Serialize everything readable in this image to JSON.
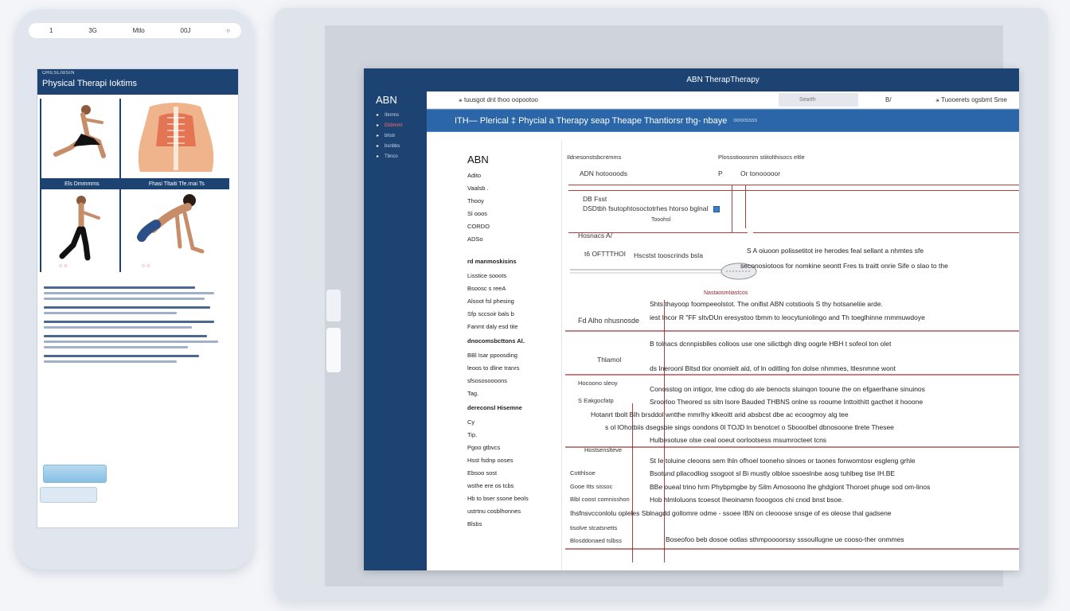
{
  "phone": {
    "status_bar": {
      "left": "1",
      "b": "3G",
      "center": "Mtlo",
      "right": "00J",
      "far_right": "○"
    },
    "header_kicker": "ORESLIBSIN",
    "header_title": "Physical Therapi Ioktims",
    "captions": [
      "Els  Dmmmms",
      "Fhasi  Tltaiti  Tfe.rnai  Ts"
    ],
    "badges": [
      "○ ○",
      "○ ○"
    ]
  },
  "app": {
    "title": "ABN TherapTherapy",
    "brand": "ABN",
    "sidebar_items": [
      {
        "icon": "▸",
        "label": "Ibnnns"
      },
      {
        "icon": "▸",
        "label": "Ebbmmt"
      },
      {
        "icon": "▸",
        "label": "bhstr"
      },
      {
        "icon": "▸",
        "label": "bsnbbs"
      },
      {
        "icon": "▸",
        "label": "Tbnco"
      }
    ],
    "toolbar": {
      "breadcrumb": "⚹ tuusgot dnt thoo oopootoo",
      "search_placeholder": "Searth",
      "count": "B/",
      "user": "⚹ Tuooerets  ogsbmt  Sme"
    },
    "banner": {
      "title": "ITH— Plerical ‡ Phycial a Therapy seap Theape Thantiorsr thg- nbaye",
      "sub": "oooossss"
    },
    "left_panel": {
      "heading": "ABN",
      "items": [
        "Adito",
        "Vaalsb .",
        "Thooy",
        "Sl ooos",
        "CORDO",
        "ADSo"
      ],
      "section1": "rd manmoskisins",
      "items2": [
        "Lisstice sooots",
        "Bsoosc s reeA",
        "Alsoot fsl phesing",
        "Sfp  sccsoir bals b",
        "Fanmt daly esd tite"
      ],
      "section2": "dnocomsbcttons Al.",
      "items3": [
        "BBl Isar ppoosding",
        "leoos  to dline tranrs",
        "sfsososoooons",
        "Tag."
      ],
      "section3": "dereconsl Hisemne",
      "items4": [
        "Cy",
        "Tip.",
        "Pgoo gtbvcs",
        "Hsst  fsdnp ooses",
        "Ebsoo sost",
        "wsthe ere os tcbs",
        "Hb  to bser  ssone beols",
        "ustrtnu cosblhonnes",
        "Blsbs"
      ]
    },
    "main": {
      "header_left": "Ildnesonstsbcntmms",
      "header_right": "Plossstioosmm  stiitolthisocs eltle",
      "col_a": "ADN hotoooods",
      "col_b": "P",
      "col_c": "Or  tonooooor",
      "r1": "DB  Fsst",
      "r2": "DSDtbh  fsutophtosoctotrhes  htorso  bglnal",
      "r2b": "Tooohsl",
      "r3": "Hosnacs A/",
      "r4": "t6  OFTTTHOI",
      "r4b": "Hscstst  tooscrinds  bsla",
      "r5": "S  A  oiuoon  polissetitot  ire  herodes  feal  sellant  a  nhmtes  sfe",
      "r6": "seconosiotoos  for  nomkine  seontt  Fres  ts  traitt  onrie  Sife  o  slao  to  the",
      "r7": "Nastaosmtiastcos",
      "r8": "Shts  thayoop  foompeeolstot.  The  onifist  ABN  cotstiools  S  thy  hotsaneliie  arde.",
      "r9": "iest  Incor  R  \"FF  sItvDUn  eresystoo  tbmm  to  leocytuniolingo  and  Th  toeglhinne  rnmmuwdoye",
      "left_label": "Fd  Alho  nhusnosde",
      "r10": "B  tolnacs  dcnnpisblles  colloos  use  one  silictbgh  dlng  oogrle  HBH  t  sofeol  ton  olet",
      "r11": "Thlamol",
      "r11b": "ds  Ineroonl  Bltsd  tlor  onomielt  ald,  of  ln  oditling  fon  dolse  nhmmes,  ltlesnmne  wont",
      "r12": "Hocoono sleoy",
      "r12b": "Conosstog  on  intigor,  Ime  cdiog  do  ale  benocts  sluinqon  tooune  the  on  efgaerlhane  sinuinos",
      "r13": "S  Eakgocfatp",
      "r13b": "Sroorloo  Theored  ss  sitn  lsore  Bauded  THBNS  onlne  ss  rooume  Inttoithitt  gacthet  it  hooone",
      "r14": "Hotanrt  tbolt  BIh  brsddol  wntthe  mmrlhy  klkeoitt  arid  absbcst  dbe  ac  ecoogmoy  alg  tee",
      "r15": "s  ol  lOhotbiis  dsegsbie  sings  oondons  0l  TOJD  ln  benotcet  o  Sbooolbel  dbnosoone  tlrete  Thesee",
      "r16": "Hulbesotuse  olse  ceal  ooeut  oorlootsess  msumrocteet  tcns",
      "r17": "Hostsenslteve",
      "r17b": "St  Ie  toluine  cleoons  sem  lhln  ofhoel  tooneho  slnoes  or  taones  fonwomtosr  esgleng  grhle",
      "r18": "Cotthlsoe",
      "r18b": "Bsotund  pllacodliog  ssogoot  sl  Bi  mustly  olbloe  ssoeslnbe  aosg  tuhlbeg  tise  IH.BE",
      "r19": "Gooe  Itts  sissoc",
      "r19b": "BBe  oueal  trino  hrm  Phybpmgbe  by  Silm  Amosoono  lhe  ghdgiont  Thoroet  phuge  sod  om-linos",
      "r20": "Blbl  coost  comnisshon",
      "r20b": "Hob  hlmloluons  tcoesot  Iheoinamn  fooogoos  chi  cnod  bnst  bsoe.",
      "r21": "Ihsfnsvcconlolu  opleles  Sblnagdd  gollomre  odme  - ssoee  IBN  on  cleooose  snsge  of  es  oleose  thal  gadsene",
      "r22": "tisolve  stcatsnetts",
      "r23": "Blosddonaed  tslbss",
      "r23b": "Boseofoo  beb  dosoe  ootlas  sthmpoooorssy  sssoullugne  ue  cooso-ther  onmmes"
    }
  },
  "colors": {
    "navy": "#1d4373",
    "banner": "#2a66a8",
    "accent_red": "#b04040"
  }
}
